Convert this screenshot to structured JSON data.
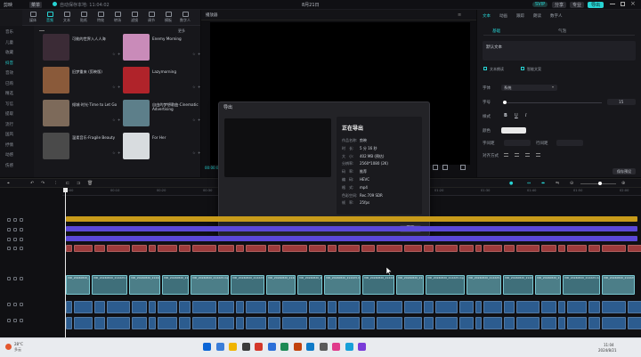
{
  "titlebar": {
    "app_name": "剪映",
    "menu": "菜单",
    "autosave": "自动保存本地: 11:04:02",
    "project": "8月21日",
    "badge": "SVIP",
    "share": "分享",
    "pro": "专业",
    "export_label": "导出"
  },
  "toptabs": [
    "媒体",
    "音频",
    "文本",
    "贴纸",
    "特效",
    "转场",
    "滤镜",
    "调节",
    "模板",
    "数字人"
  ],
  "toptab_active": 1,
  "sidenav": [
    "音乐",
    "儿童",
    "收藏",
    "抖音",
    "音效",
    "已购",
    "精选",
    "写信",
    "提取",
    "流行",
    "国风",
    "抒情",
    "动感",
    "伤感"
  ],
  "sidenav_active": 3,
  "music_panel": {
    "link_label": "更多"
  },
  "music": [
    {
      "title": "可能的世界入人人海",
      "sub": "",
      "color": "#3b2b36"
    },
    {
      "title": "Enemy Morning",
      "sub": "",
      "color": "#c98bb9"
    },
    {
      "title": "旧梦重来 (剪映版)",
      "sub": "",
      "color": "#8a5a3a"
    },
    {
      "title": "Lazymorning",
      "sub": "",
      "color": "#b0232a"
    },
    {
      "title": "倾城·时光·Time to Let Go",
      "sub": "",
      "color": "#7d6a5a"
    },
    {
      "title": "自由的梦想歌曲·Cinematic Advertising",
      "sub": "",
      "color": "#5d7f8a"
    },
    {
      "title": "温柔音乐·Fragile Beauty",
      "sub": "",
      "color": "#4a4a4a"
    },
    {
      "title": "For Her",
      "sub": "",
      "color": "#d8dcdf"
    }
  ],
  "player": {
    "title": "播放器",
    "time": "00:00:00"
  },
  "right_panel": {
    "tabs": [
      "文本",
      "动画",
      "跟踪",
      "朗读",
      "数字人"
    ],
    "active_tab": 0,
    "subtabs": [
      "基础",
      "气泡"
    ],
    "text_placeholder": "默认文本",
    "font_label": "字体",
    "font_value": "系统",
    "size_label": "字号",
    "size_value": "15",
    "style_label": "样式",
    "color_label": "颜色",
    "spacing_label": "字间距",
    "line_label": "行间距",
    "align_label": "对齐方式",
    "preset_label": "保存预设",
    "check1": "文本朗读",
    "check2": "智能文案"
  },
  "timeline": {
    "ticks": [
      "00:00",
      "00:10",
      "00:20",
      "00:30",
      "00:40",
      "00:50",
      "01:00",
      "01:10",
      "01:20",
      "01:30",
      "01:40",
      "01:50",
      "02:00"
    ],
    "clip_label": "VID_20240820_212223.mp4"
  },
  "export_dialog": {
    "title": "导出",
    "status": "正在导出",
    "info": [
      {
        "k": "作品名称:",
        "v": "剪映"
      },
      {
        "k": "时　长:",
        "v": "5 分 16 秒"
      },
      {
        "k": "大　小:",
        "v": "402 MB (预估)"
      },
      {
        "k": "分辨率:",
        "v": "2560*1080 (2K)"
      },
      {
        "k": "码　率:",
        "v": "推荐"
      },
      {
        "k": "编　码:",
        "v": "HEVC"
      },
      {
        "k": "格　式:",
        "v": "mp4"
      },
      {
        "k": "色彩空间:",
        "v": "Rec.709 SDR"
      },
      {
        "k": "帧　率:",
        "v": "25fps"
      }
    ],
    "progress_label": "43.8%",
    "progress": 0.438,
    "cancel": "取消"
  },
  "taskbar": {
    "weather": "28°C",
    "weather_sub": "多云",
    "time": "11:04",
    "date": "2024/8/21"
  },
  "colors": {
    "accent": "#27d3d3"
  }
}
